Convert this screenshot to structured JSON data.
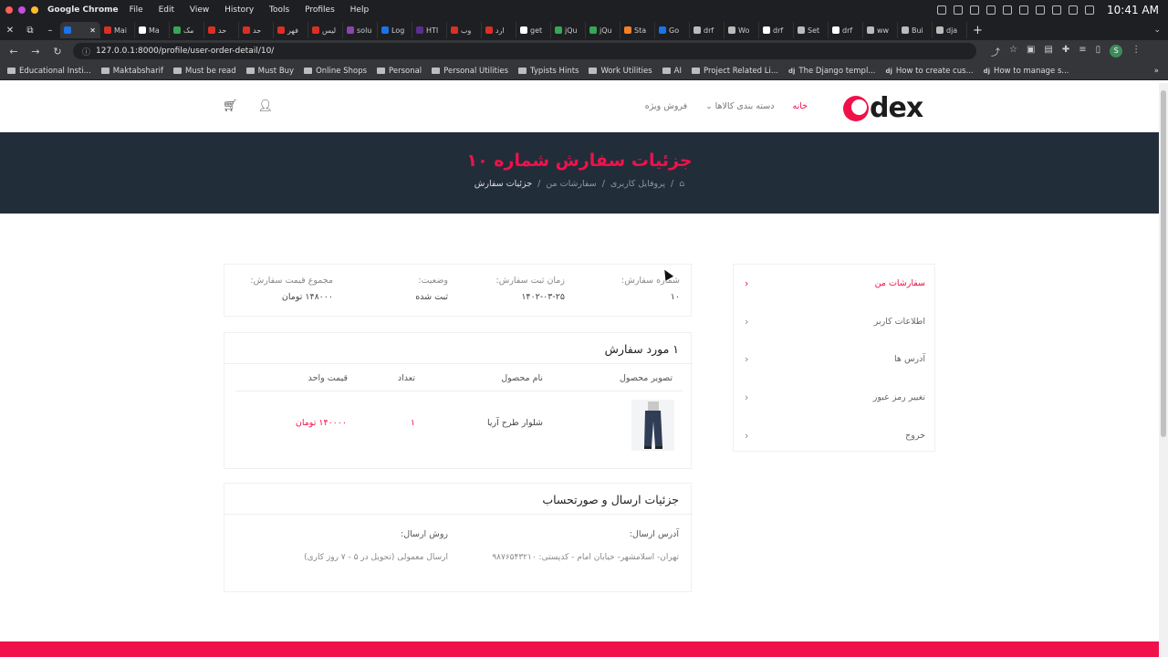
{
  "os": {
    "app": "Google Chrome",
    "menu": [
      "File",
      "Edit",
      "View",
      "History",
      "Tools",
      "Profiles",
      "Help"
    ],
    "clock": "10:41 AM",
    "dot_colors": [
      "#ff5f57",
      "#c64be0",
      "#febc2e"
    ]
  },
  "tabs": [
    {
      "label": "",
      "color": "#1a73e8",
      "active": true
    },
    {
      "label": "Mai",
      "color": "#d93025"
    },
    {
      "label": "Ma",
      "color": "#ffffff"
    },
    {
      "label": "مک",
      "color": "#34a853"
    },
    {
      "label": "حد",
      "color": "#d93025"
    },
    {
      "label": "حد",
      "color": "#d93025"
    },
    {
      "label": "فهر",
      "color": "#d93025"
    },
    {
      "label": "لیس",
      "color": "#d93025"
    },
    {
      "label": "solu",
      "color": "#8e44ad"
    },
    {
      "label": "Log",
      "color": "#1a73e8"
    },
    {
      "label": "HTI",
      "color": "#5c2d91"
    },
    {
      "label": "وب",
      "color": "#d93025"
    },
    {
      "label": "ارد",
      "color": "#d93025"
    },
    {
      "label": "get",
      "color": "#ffffff"
    },
    {
      "label": "jQu",
      "color": "#34a853"
    },
    {
      "label": "jQu",
      "color": "#34a853"
    },
    {
      "label": "Sta",
      "color": "#f48024"
    },
    {
      "label": "Go",
      "color": "#1a73e8"
    },
    {
      "label": "drf",
      "color": "#bbbbbb"
    },
    {
      "label": "Wo",
      "color": "#bbbbbb"
    },
    {
      "label": "drf",
      "color": "#ffffff"
    },
    {
      "label": "Set",
      "color": "#bbbbbb"
    },
    {
      "label": "drf",
      "color": "#ffffff"
    },
    {
      "label": "ww",
      "color": "#bbbbbb"
    },
    {
      "label": "Bui",
      "color": "#bbbbbb"
    },
    {
      "label": "dja",
      "color": "#bbbbbb"
    }
  ],
  "address": {
    "url": "127.0.0.1:8000/profile/user-order-detail/10/"
  },
  "bookmarks": [
    {
      "label": "Educational Insti...",
      "kind": "folder"
    },
    {
      "label": "Maktabsharif",
      "kind": "folder"
    },
    {
      "label": "Must be read",
      "kind": "folder"
    },
    {
      "label": "Must Buy",
      "kind": "folder"
    },
    {
      "label": "Online Shops",
      "kind": "folder"
    },
    {
      "label": "Personal",
      "kind": "folder"
    },
    {
      "label": "Personal Utilities",
      "kind": "folder"
    },
    {
      "label": "Typists Hints",
      "kind": "folder"
    },
    {
      "label": "Work Utilities",
      "kind": "folder"
    },
    {
      "label": "AI",
      "kind": "folder"
    },
    {
      "label": "Project Related Li...",
      "kind": "folder"
    },
    {
      "label": "The Django templ...",
      "kind": "dj"
    },
    {
      "label": "How to create cus...",
      "kind": "dj"
    },
    {
      "label": "How to manage s...",
      "kind": "dj"
    }
  ],
  "site": {
    "brand": "dex",
    "brand_color": "#f0114a",
    "nav": [
      "خانه",
      "دسته بندی کالاها",
      "فروش ویژه"
    ]
  },
  "banner": {
    "title": "جزئیات سفارش شماره ۱۰",
    "crumbs": [
      "پروفایل کاربری",
      "سفارشات من",
      "جزئیات سفارش"
    ]
  },
  "sidebar": [
    {
      "label": "سفارشات من",
      "active": true
    },
    {
      "label": "اطلاعات کاربر"
    },
    {
      "label": "آدرس ها"
    },
    {
      "label": "تغییر رمز عبور"
    },
    {
      "label": "خروج"
    }
  ],
  "summary": {
    "order_no_label": "شماره سفارش:",
    "order_no": "۱۰",
    "date_label": "زمان ثبت سفارش:",
    "date": "۱۴۰۲-۰۳-۲۵",
    "status_label": "وضعیت:",
    "status": "ثبت شده",
    "total_label": "مجموع قیمت سفارش:",
    "total": "۱۴۸۰۰۰ تومان"
  },
  "items": {
    "title": "۱ مورد سفارش",
    "columns": [
      "تصویر محصول",
      "نام محصول",
      "تعداد",
      "قیمت واحد"
    ],
    "rows": [
      {
        "name": "شلوار طرح آریا",
        "qty": "۱",
        "price": "۱۴۰۰۰۰ تومان"
      }
    ]
  },
  "shipping": {
    "title": "جزئیات ارسال و صورتحساب",
    "address_label": "آدرس ارسال:",
    "address": "تهران- اسلامشهر- خیابان امام - کدپستی: ۹۸۷۶۵۴۳۲۱۰",
    "method_label": "روش ارسال:",
    "method": "ارسال معمولی (تحویل در ۵ - ۷ روز کاری)"
  }
}
